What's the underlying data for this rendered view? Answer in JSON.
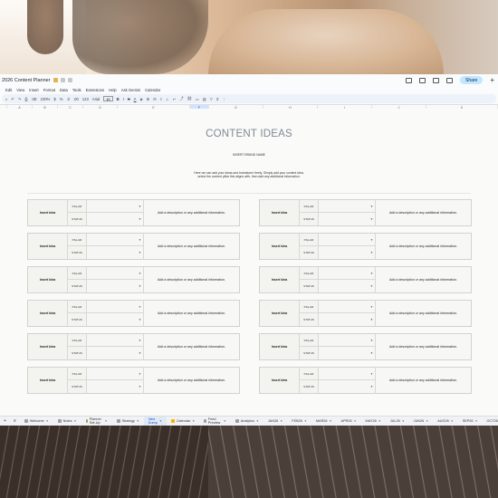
{
  "window": {
    "title": "2026 Content Planner",
    "share_label": "Share"
  },
  "menu": [
    "Edit",
    "View",
    "Insert",
    "Format",
    "Data",
    "Tools",
    "Extensions",
    "Help",
    "Ask Gemini",
    "Calendar"
  ],
  "toolbar": {
    "zoom": "100%",
    "currency": "$",
    "percent": "%",
    "decimals_a": ".0",
    "decimals_b": ".00",
    "number_format": "123",
    "font": "Arial",
    "font_size": "10"
  },
  "columns": [
    "A",
    "B",
    "C",
    "D",
    "E",
    "F",
    "G",
    "H",
    "I",
    "J",
    "K"
  ],
  "sheet": {
    "title": "CONTENT IDEAS",
    "brand": "INSERT BRAND NAME",
    "intro_line1": "Here we can add your ideas and brainstorm freely. Simply add your content idea,",
    "intro_line2": "select the content pillar this aligns with, then add any additional information."
  },
  "card": {
    "name": "Insert Idea",
    "pillar_label": "PILLAR",
    "status_label": "STATUS",
    "description": "Add a description or any additional information."
  },
  "ideas_left": [
    {
      "name": "Insert Idea",
      "pillar": "",
      "status": "",
      "description": "Add a description or any additional information."
    },
    {
      "name": "Insert Idea",
      "pillar": "",
      "status": "",
      "description": "Add a description or any additional information."
    },
    {
      "name": "Insert Idea",
      "pillar": "",
      "status": "",
      "description": "Add a description or any additional information."
    },
    {
      "name": "Insert Idea",
      "pillar": "",
      "status": "",
      "description": "Add a description or any additional information."
    },
    {
      "name": "Insert Idea",
      "pillar": "",
      "status": "",
      "description": "Add a description or any additional information."
    },
    {
      "name": "Insert Idea",
      "pillar": "",
      "status": "",
      "description": "Add a description or any additional information."
    }
  ],
  "ideas_right": [
    {
      "name": "Insert Idea",
      "pillar": "",
      "status": "",
      "description": "Add a description or any additional information."
    },
    {
      "name": "Insert Idea",
      "pillar": "",
      "status": "",
      "description": "Add a description or any additional information."
    },
    {
      "name": "Insert Idea",
      "pillar": "",
      "status": "",
      "description": "Add a description or any additional information."
    },
    {
      "name": "Insert Idea",
      "pillar": "",
      "status": "",
      "description": "Add a description or any additional information."
    },
    {
      "name": "Insert Idea",
      "pillar": "",
      "status": "",
      "description": "Add a description or any additional information."
    },
    {
      "name": "Insert Idea",
      "pillar": "",
      "status": "",
      "description": "Add a description or any additional information."
    }
  ],
  "tabs": [
    {
      "label": "Welcome",
      "color": "#9e9e9e",
      "active": false
    },
    {
      "label": "Notes",
      "color": "#9e9e9e",
      "active": false
    },
    {
      "label": "Planner Set-Up",
      "color": "#7cb342",
      "active": false
    },
    {
      "label": "Strategy",
      "color": "#9e9e9e",
      "active": false
    },
    {
      "label": "Idea Dump",
      "color": "#9e9e9e",
      "active": true
    },
    {
      "label": "Calendar",
      "color": "#f4b400",
      "active": false
    },
    {
      "label": "Feed Preview",
      "color": "#9e9e9e",
      "active": false
    },
    {
      "label": "Analytics",
      "color": "#9e9e9e",
      "active": false
    },
    {
      "label": "JAN26",
      "color": "#9e9e9e",
      "active": false
    },
    {
      "label": "FEB26",
      "color": "#9e9e9e",
      "active": false
    },
    {
      "label": "MAR26",
      "color": "#9e9e9e",
      "active": false
    },
    {
      "label": "APR26",
      "color": "#9e9e9e",
      "active": false
    },
    {
      "label": "MAY26",
      "color": "#9e9e9e",
      "active": false
    },
    {
      "label": "JUL26",
      "color": "#9e9e9e",
      "active": false
    },
    {
      "label": "JUN26",
      "color": "#9e9e9e",
      "active": false
    },
    {
      "label": "AUG26",
      "color": "#9e9e9e",
      "active": false
    },
    {
      "label": "SEP26",
      "color": "#9e9e9e",
      "active": false
    },
    {
      "label": "OCT26",
      "color": "#9e9e9e",
      "active": false
    },
    {
      "label": "NC",
      "color": "#9e9e9e",
      "active": false
    }
  ]
}
